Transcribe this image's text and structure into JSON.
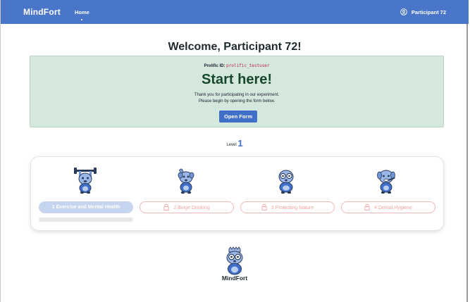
{
  "nav": {
    "brand": "MindFort",
    "home_label": "Home",
    "user_label": "Participant 72"
  },
  "main": {
    "welcome": "Welcome, Participant 72!",
    "prolific_label": "Prolific ID:",
    "prolific_id": "prolific_testuser",
    "start_heading": "Start here!",
    "thanks_line1": "Thank you for participating in our experiment.",
    "thanks_line2": "Please begin by opening the form below.",
    "open_form_label": "Open Form",
    "level_label": "Level",
    "level_value": "1"
  },
  "modules": [
    {
      "label": "1 Exercise and Mental Health",
      "state": "active",
      "progress": 0
    },
    {
      "label": "2 Binge Drinking",
      "state": "locked"
    },
    {
      "label": "3 Protecting Nature",
      "state": "locked"
    },
    {
      "label": "4 Dental Hygiene",
      "state": "locked"
    }
  ],
  "footer": {
    "brand": "MindFort"
  },
  "colors": {
    "navbar": "#4a76c9",
    "panel": "#d4e8dd",
    "accent": "#3f6fc8",
    "locked": "#f2a5a5"
  }
}
